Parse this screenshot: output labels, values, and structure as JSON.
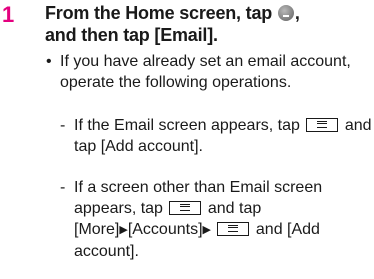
{
  "step": {
    "number": "1",
    "heading_line1_pre": "From the Home screen, tap",
    "heading_line1_post": ",",
    "heading_line2": "and then tap [Email]."
  },
  "bullet": {
    "dot": "•",
    "text": "If you have already set an email account, operate the following operations."
  },
  "sub_items": [
    {
      "dash": "-",
      "pre": "If the Email screen appears, tap",
      "post": "and tap [Add account]."
    },
    {
      "dash": "-",
      "pre": "If a screen other than Email screen appears, tap",
      "mid1": "and tap [More]",
      "mid2": "[Accounts]",
      "post": "and [Add account]."
    }
  ],
  "glyphs": {
    "arrow": "▶"
  },
  "icons": {
    "home_icon": "apps-icon",
    "menu_key": "menu-key-icon"
  }
}
